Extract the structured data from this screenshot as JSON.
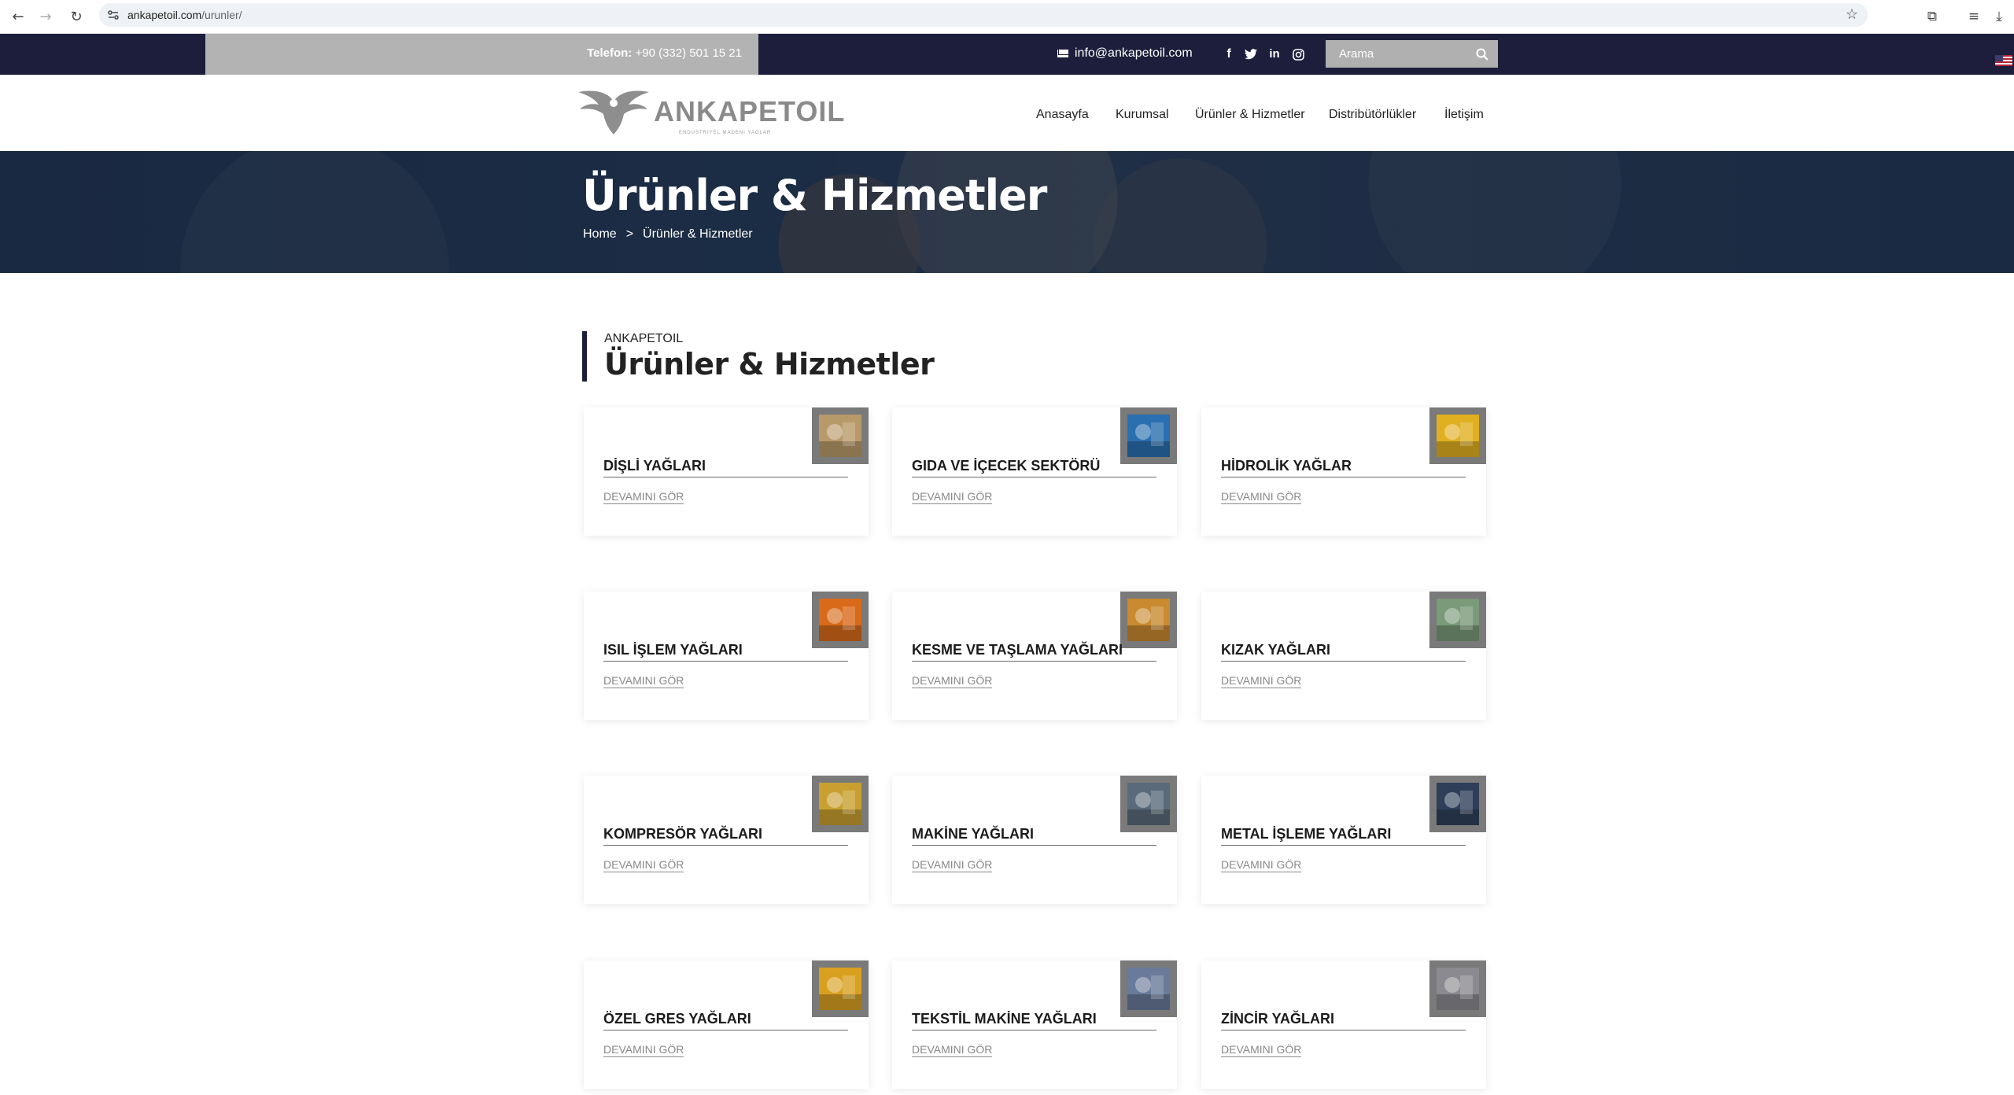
{
  "browser": {
    "url_host": "ankapetoil.com",
    "url_path": "/urunler/"
  },
  "topbar": {
    "phone_label": "Telefon:",
    "phone_number": "+90 (332) 501 15 21",
    "email": "info@ankapetoil.com",
    "social": [
      "f",
      "t",
      "in",
      "ig"
    ],
    "search_placeholder": "Arama"
  },
  "header": {
    "logo_text": "ANKAPETOIL",
    "logo_sub": "ENDUSTRIYEL MADENI YAGLAR",
    "menu": [
      "Anasayfa",
      "Kurumsal",
      "Ürünler & Hizmetler",
      "Distribütörlükler",
      "İletişim"
    ]
  },
  "hero": {
    "title": "Ürünler & Hizmetler",
    "crumb_home": "Home",
    "crumb_sep": ">",
    "crumb_current": "Ürünler & Hizmetler"
  },
  "section": {
    "kicker": "ANKAPETOIL",
    "title": "Ürünler & Hizmetler"
  },
  "products": [
    {
      "title": "DİŞLİ YAĞLARI",
      "more": "DEVAMINI GÖR",
      "thumb_color": "#b89a6a"
    },
    {
      "title": "GIDA VE İÇECEK SEKTÖRÜ",
      "more": "DEVAMINI GÖR",
      "thumb_color": "#2a6fb0"
    },
    {
      "title": "HİDROLİK YAĞLAR",
      "more": "DEVAMINI GÖR",
      "thumb_color": "#e0b020"
    },
    {
      "title": "ISIL İŞLEM YAĞLARI",
      "more": "DEVAMINI GÖR",
      "thumb_color": "#d96a1a"
    },
    {
      "title": "KESME VE TAŞLAMA YAĞLARI",
      "more": "DEVAMINI GÖR",
      "thumb_color": "#c98a30"
    },
    {
      "title": "KIZAK YAĞLARI",
      "more": "DEVAMINI GÖR",
      "thumb_color": "#7a9a7a"
    },
    {
      "title": "KOMPRESÖR YAĞLARI",
      "more": "DEVAMINI GÖR",
      "thumb_color": "#c9a030"
    },
    {
      "title": "MAKİNE YAĞLARI",
      "more": "DEVAMINI GÖR",
      "thumb_color": "#5a6a7a"
    },
    {
      "title": "METAL İŞLEME YAĞLARI",
      "more": "DEVAMINI GÖR",
      "thumb_color": "#2f3f5a"
    },
    {
      "title": "ÖZEL GRES YAĞLARI",
      "more": "DEVAMINI GÖR",
      "thumb_color": "#d9a020"
    },
    {
      "title": "TEKSTİL MAKİNE YAĞLARI",
      "more": "DEVAMINI GÖR",
      "thumb_color": "#6a7a9a"
    },
    {
      "title": "ZİNCİR YAĞLARI",
      "more": "DEVAMINI GÖR",
      "thumb_color": "#8a8a90"
    }
  ],
  "colors": {
    "topbar_bg": "#1c1e3b",
    "phone_box_bg": "#b3b3b3",
    "accent_bar": "#1c1e3b"
  }
}
